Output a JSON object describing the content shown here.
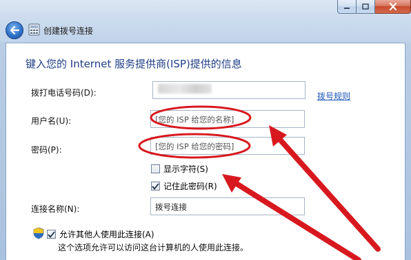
{
  "window": {
    "title": "创建拨号连接",
    "caption": {
      "minimize": "minimize",
      "maximize": "maximize",
      "close": "close"
    }
  },
  "heading": "键入您的 Internet 服务提供商(ISP)提供的信息",
  "form": {
    "phone": {
      "label": "拨打电话号码(D):",
      "value": "",
      "dial_rules_link": "拨号规则"
    },
    "username": {
      "label": "用户名(U):",
      "placeholder": "[您的 ISP 给您的名称]"
    },
    "password": {
      "label": "密码(P):",
      "placeholder": "[您的 ISP 给您的密码]"
    },
    "show_chars": {
      "label": "显示字符(S)",
      "checked": false
    },
    "remember_password": {
      "label": "记住此密码(R)",
      "checked": true
    },
    "connection_name": {
      "label": "连接名称(N):",
      "value": "拨号连接"
    },
    "allow_others": {
      "label": "允许其他人使用此连接(A)",
      "checked": true,
      "note": "这个选项允许可以访问这台计算机的人使用此连接。"
    }
  },
  "colors": {
    "heading": "#1f3f87",
    "link": "#1a56b8",
    "annotation_red": "#d7191f"
  },
  "icons": [
    "back-arrow-icon",
    "dialer-icon",
    "checkmark-icon",
    "uac-shield-icon",
    "minimize-icon",
    "maximize-icon",
    "close-icon"
  ]
}
